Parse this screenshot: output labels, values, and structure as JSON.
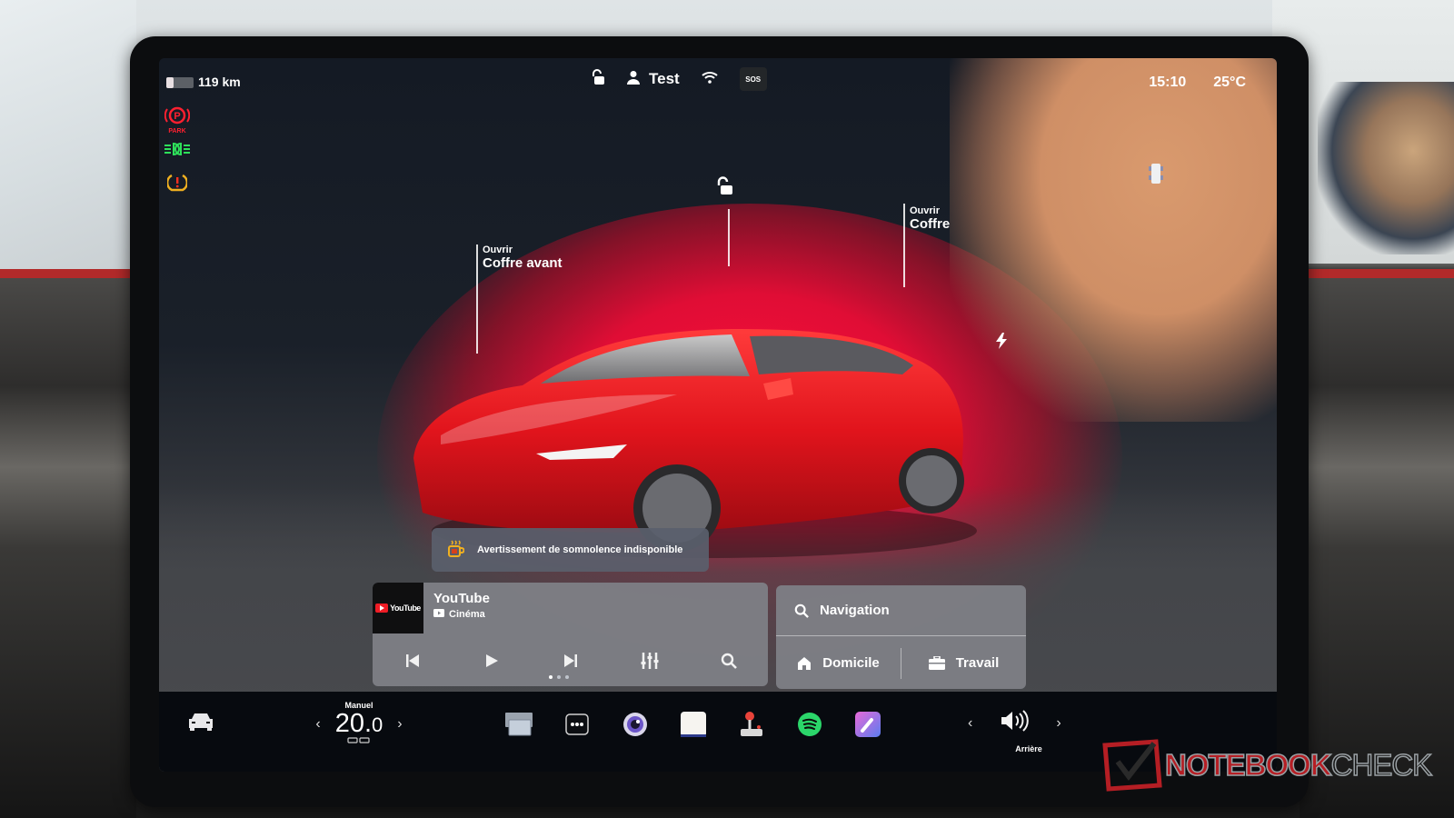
{
  "status_bar": {
    "battery_level": 0.25,
    "range": "119 km",
    "profile_name": "Test",
    "sos_label": "SOS",
    "time": "15:10",
    "temperature": "25°C"
  },
  "telltales": {
    "park_label": "PARK",
    "colors": {
      "park": "#ff2030",
      "lights": "#2ee05a",
      "tpms": "#f0b020"
    }
  },
  "vehicle_view": {
    "frunk": {
      "action": "Ouvrir",
      "label": "Coffre avant"
    },
    "trunk": {
      "action": "Ouvrir",
      "label": "Coffre"
    },
    "accent_color": "#e00d35"
  },
  "alert": {
    "text": "Avertissement de somnolence indisponible"
  },
  "media": {
    "source_logo": "YouTube",
    "title": "YouTube",
    "subtitle": "Cinéma"
  },
  "navigation": {
    "search_label": "Navigation",
    "home_label": "Domicile",
    "work_label": "Travail"
  },
  "dock": {
    "climate_mode": "Manuel",
    "temperature": "20.0",
    "temperature_int": "20.",
    "temperature_dec": "0",
    "volume_label": "Arrière",
    "apps": [
      "Écran",
      "Plus",
      "Caméra",
      "Notes",
      "Jeux",
      "Spotify",
      "Karaoké"
    ]
  },
  "watermark": {
    "part1": "NOTEBOOK",
    "part2": "CHECK"
  }
}
